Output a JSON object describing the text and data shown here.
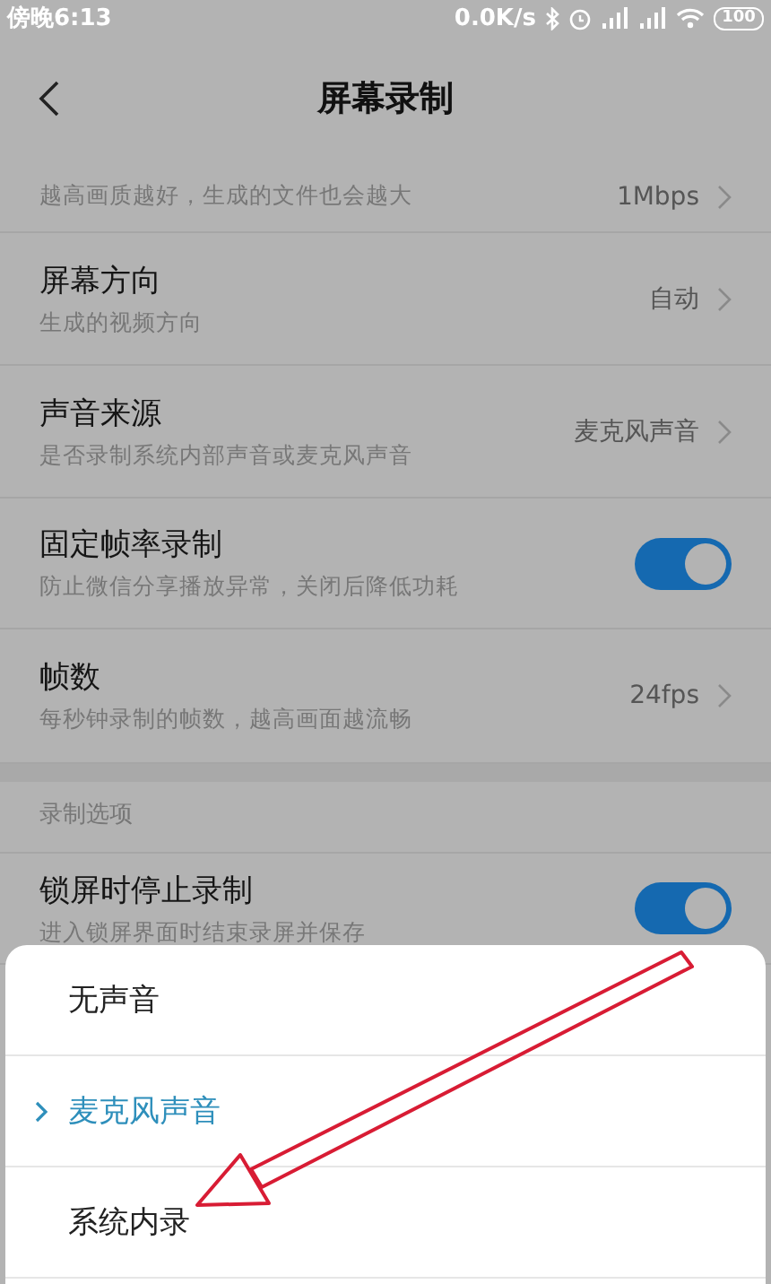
{
  "status_bar": {
    "time": "傍晚6:13",
    "network_speed": "0.0K/s",
    "battery": "100"
  },
  "header": {
    "title": "屏幕录制"
  },
  "settings": [
    {
      "kind": "value",
      "subtitle": "越高画质越好，生成的文件也会越大",
      "value": "1Mbps"
    },
    {
      "kind": "value",
      "title": "屏幕方向",
      "subtitle": "生成的视频方向",
      "value": "自动"
    },
    {
      "kind": "value",
      "title": "声音来源",
      "subtitle": "是否录制系统内部声音或麦克风声音",
      "value": "麦克风声音"
    },
    {
      "kind": "toggle",
      "title": "固定帧率录制",
      "subtitle": "防止微信分享播放异常，关闭后降低功耗",
      "on": true
    },
    {
      "kind": "value",
      "title": "帧数",
      "subtitle": "每秒钟录制的帧数，越高画面越流畅",
      "value": "24fps"
    }
  ],
  "section": {
    "header": "录制选项",
    "settings": [
      {
        "kind": "toggle",
        "title": "锁屏时停止录制",
        "subtitle": "进入锁屏界面时结束录屏并保存",
        "on": true
      }
    ]
  },
  "sheet": {
    "options": [
      {
        "label": "无声音",
        "selected": false
      },
      {
        "label": "麦克风声音",
        "selected": true
      },
      {
        "label": "系统内录",
        "selected": false
      }
    ]
  }
}
